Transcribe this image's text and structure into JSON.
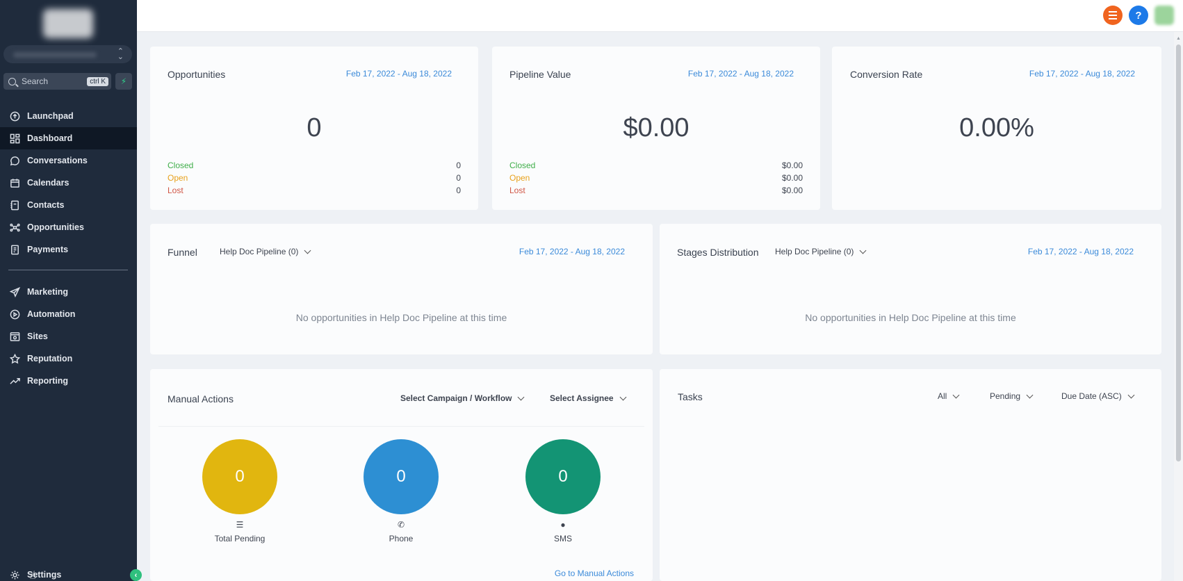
{
  "sidebar": {
    "search_label": "Search",
    "search_shortcut": "ctrl K",
    "items": [
      {
        "label": "Launchpad",
        "icon": "launchpad-icon"
      },
      {
        "label": "Dashboard",
        "icon": "dashboard-icon",
        "active": true
      },
      {
        "label": "Conversations",
        "icon": "chat-icon"
      },
      {
        "label": "Calendars",
        "icon": "calendar-icon"
      },
      {
        "label": "Contacts",
        "icon": "contacts-icon"
      },
      {
        "label": "Opportunities",
        "icon": "opportunities-icon"
      },
      {
        "label": "Payments",
        "icon": "payments-icon"
      }
    ],
    "items2": [
      {
        "label": "Marketing",
        "icon": "send-icon"
      },
      {
        "label": "Automation",
        "icon": "automation-icon"
      },
      {
        "label": "Sites",
        "icon": "sites-icon"
      },
      {
        "label": "Reputation",
        "icon": "star-icon"
      },
      {
        "label": "Reporting",
        "icon": "trend-icon"
      }
    ],
    "settings_label": "Settings"
  },
  "topbar": {
    "help_label": "?"
  },
  "cards": {
    "opportunities": {
      "title": "Opportunities",
      "date": "Feb 17, 2022 - Aug 18, 2022",
      "value": "0",
      "closed_label": "Closed",
      "closed_value": "0",
      "open_label": "Open",
      "open_value": "0",
      "lost_label": "Lost",
      "lost_value": "0"
    },
    "pipeline": {
      "title": "Pipeline Value",
      "date": "Feb 17, 2022 - Aug 18, 2022",
      "value": "$0.00",
      "closed_label": "Closed",
      "closed_value": "$0.00",
      "open_label": "Open",
      "open_value": "$0.00",
      "lost_label": "Lost",
      "lost_value": "$0.00"
    },
    "conversion": {
      "title": "Conversion Rate",
      "date": "Feb 17, 2022 - Aug 18, 2022",
      "value": "0.00%"
    },
    "funnel": {
      "title": "Funnel",
      "pipeline": "Help Doc Pipeline (0)",
      "date": "Feb 17, 2022 - Aug 18, 2022",
      "empty": "No opportunities in Help Doc Pipeline at this time"
    },
    "stages": {
      "title": "Stages Distribution",
      "pipeline": "Help Doc Pipeline (0)",
      "date": "Feb 17, 2022 - Aug 18, 2022",
      "empty": "No opportunities in Help Doc Pipeline at this time"
    },
    "manual": {
      "title": "Manual Actions",
      "campaign_select": "Select Campaign / Workflow",
      "assignee_select": "Select Assignee",
      "total_value": "0",
      "total_label": "Total Pending",
      "phone_value": "0",
      "phone_label": "Phone",
      "sms_value": "0",
      "sms_label": "SMS",
      "link": "Go to Manual Actions",
      "colors": {
        "total": "#e1b60f",
        "phone": "#2d8fd3",
        "sms": "#139474"
      }
    },
    "tasks": {
      "title": "Tasks",
      "filter_all": "All",
      "filter_status": "Pending",
      "filter_sort": "Due Date (ASC)"
    }
  }
}
